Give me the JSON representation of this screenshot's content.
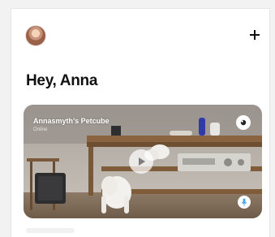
{
  "header": {
    "avatar_icon": "user-avatar",
    "add_icon": "plus-icon",
    "greeting_sub": "",
    "greeting": "Hey, Anna"
  },
  "camera": {
    "title": "Annasmyth's Petcube",
    "status": "Online",
    "record_icon": "record-icon",
    "play_icon": "play-icon",
    "mic_icon": "microphone-icon"
  },
  "colors": {
    "background": "#ffffff",
    "text": "#111111",
    "accent": "#4aa7e8"
  }
}
